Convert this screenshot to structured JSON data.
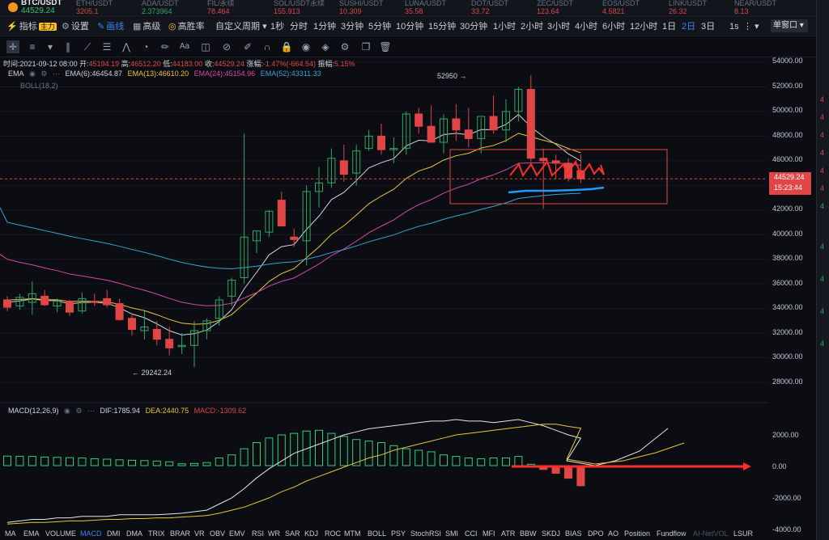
{
  "ticker": {
    "main": {
      "symbol": "BTC/USDT",
      "price": "44529.24"
    },
    "items": [
      {
        "symbol": "ETH/USDT",
        "price": "3205.1",
        "dir": "down"
      },
      {
        "symbol": "ADA/USDT",
        "price": "2.373964",
        "dir": "up"
      },
      {
        "symbol": "FIL/永续",
        "price": "78.464",
        "dir": "down"
      },
      {
        "symbol": "SOL/USDT永续",
        "price": "155.913",
        "dir": "down"
      },
      {
        "symbol": "SUSHI/USDT",
        "price": "10.309",
        "dir": "down"
      },
      {
        "symbol": "LUNA/USDT",
        "price": "35.58",
        "dir": "down"
      },
      {
        "symbol": "DOT/USDT",
        "price": "33.72",
        "dir": "down"
      },
      {
        "symbol": "ZEC/USDT",
        "price": "123.64",
        "dir": "down"
      },
      {
        "symbol": "EOS/USDT",
        "price": "4.5821",
        "dir": "down"
      },
      {
        "symbol": "LINK/USDT",
        "price": "26.32",
        "dir": "down"
      },
      {
        "symbol": "NEAR/USDT",
        "price": "8.13",
        "dir": "down"
      }
    ]
  },
  "toolbar": {
    "indicator": "指标",
    "indicator_badge": "主力",
    "settings": "设置",
    "drawing": "画线",
    "advanced": "高级",
    "win_rate": "高胜率",
    "custom_period": "自定义周期",
    "periods": [
      "1秒",
      "分时",
      "1分钟",
      "3分钟",
      "5分钟",
      "10分钟",
      "15分钟",
      "30分钟",
      "1小时",
      "2小时",
      "3小时",
      "4小时",
      "6小时",
      "12小时",
      "1日",
      "2日",
      "3日"
    ],
    "selected_period": "2日",
    "right_1s": "1s",
    "window_mode": "单窗口"
  },
  "info": {
    "time_label": "时间:",
    "time": "2021-09-12 08:00",
    "open_label": "开:",
    "open": "45194.19",
    "high_label": "高:",
    "high": "46512.20",
    "low_label": "低:",
    "low": "44183.00",
    "close_label": "收:",
    "close": "44529.24",
    "change_label": "涨幅:",
    "change": "-1.47%(-664.54)",
    "amp_label": "振幅:",
    "amp": "5.15%"
  },
  "ema_legend": {
    "name": "EMA",
    "items": [
      {
        "text": "EMA(6):46454.87",
        "color": "#d1d5db"
      },
      {
        "text": "EMA(13):46610.20",
        "color": "#e9c53d"
      },
      {
        "text": "EMA(24):45154.96",
        "color": "#d946a8"
      },
      {
        "text": "EMA(52):43311.33",
        "color": "#38a3d1"
      }
    ]
  },
  "boll_legend": "BOLL(18,2)",
  "macd_legend": {
    "name": "MACD(12,26,9)",
    "dif": "DIF:1785.94",
    "dea": "DEA:2440.75",
    "macd": "MACD:-1309.62"
  },
  "annotations": {
    "high": "52950",
    "low": "29242.24"
  },
  "price_axis": [
    "54000.00",
    "52000.00",
    "50000.00",
    "48000.00",
    "46000.00",
    "44000.00",
    "42000.00",
    "40000.00",
    "38000.00",
    "36000.00",
    "34000.00",
    "32000.00",
    "30000.00",
    "28000.00"
  ],
  "macd_axis": [
    "2000.00",
    "0.00",
    "-2000.00",
    "-4000.00"
  ],
  "price_tag": {
    "price": "44529.24",
    "countdown": "15:23:44"
  },
  "bottom_tabs": [
    "MA",
    "EMA",
    "VOLUME",
    "MACD",
    "DMI",
    "DMA",
    "TRIX",
    "BRAR",
    "VR",
    "OBV",
    "EMV",
    "RSI",
    "WR",
    "SAR",
    "KDJ",
    "ROC",
    "MTM",
    "BOLL",
    "PSY",
    "StochRSI",
    "SMI",
    "CCI",
    "MFI",
    "ATR",
    "BBW",
    "SKDJ",
    "BIAS",
    "DPO",
    "AO",
    "Position",
    "Fundflow",
    "AI-NetVOL",
    "LSUR"
  ],
  "bottom_selected": "MACD",
  "colors": {
    "up": "#2ea865",
    "down": "#e04646",
    "accent": "#3b82f6",
    "bg": "#0b0d12"
  },
  "chart_data": {
    "type": "candlestick",
    "ylim": [
      26000,
      55000
    ],
    "candles": [
      [
        34700,
        35000,
        33800,
        34100
      ],
      [
        34200,
        35200,
        33900,
        34900
      ],
      [
        34500,
        36200,
        33500,
        35200
      ],
      [
        35000,
        35500,
        34200,
        34300
      ],
      [
        34200,
        34800,
        33700,
        34600
      ],
      [
        34600,
        34700,
        33400,
        33700
      ],
      [
        33800,
        35300,
        33600,
        34800
      ],
      [
        34600,
        35200,
        34200,
        34500
      ],
      [
        34800,
        35500,
        34100,
        34300
      ],
      [
        34400,
        34800,
        33000,
        33100
      ],
      [
        33200,
        33600,
        31800,
        32300
      ],
      [
        32200,
        33800,
        31500,
        32500
      ],
      [
        32300,
        33000,
        31000,
        31500
      ],
      [
        31500,
        32500,
        30200,
        30800
      ],
      [
        30900,
        32000,
        30300,
        31000
      ],
      [
        31000,
        33000,
        29242,
        32200
      ],
      [
        32200,
        33200,
        31500,
        33000
      ],
      [
        33200,
        35000,
        32600,
        34700
      ],
      [
        35000,
        36500,
        34200,
        36300
      ],
      [
        36500,
        48200,
        36000,
        39800
      ],
      [
        39500,
        40300,
        38500,
        40300
      ],
      [
        40200,
        42000,
        39800,
        41900
      ],
      [
        42800,
        43500,
        40800,
        40700
      ],
      [
        39800,
        40500,
        39000,
        39600
      ],
      [
        39500,
        44000,
        37500,
        43500
      ],
      [
        43500,
        45500,
        42200,
        44200
      ],
      [
        44200,
        47000,
        43800,
        46200
      ],
      [
        46000,
        47300,
        44300,
        44900
      ],
      [
        45000,
        47300,
        44000,
        46800
      ],
      [
        47000,
        48500,
        46800,
        48000
      ],
      [
        48000,
        49000,
        46500,
        46900
      ],
      [
        46900,
        47900,
        45800,
        47000
      ],
      [
        47000,
        50000,
        46500,
        49800
      ],
      [
        49800,
        50300,
        48200,
        48800
      ],
      [
        48800,
        50500,
        47900,
        47500
      ],
      [
        47500,
        49800,
        46600,
        49400
      ],
      [
        49400,
        50600,
        47600,
        48500
      ],
      [
        48500,
        50300,
        47100,
        47800
      ],
      [
        47800,
        49500,
        46600,
        49600
      ],
      [
        49600,
        51300,
        48200,
        48500
      ],
      [
        48500,
        51000,
        47500,
        50000
      ],
      [
        50000,
        52000,
        49200,
        51800
      ],
      [
        51800,
        52950,
        45900,
        46200
      ],
      [
        46200,
        47000,
        42100,
        46000
      ],
      [
        46000,
        46500,
        44500,
        45800
      ],
      [
        45800,
        46200,
        44300,
        44600
      ],
      [
        45194,
        46512,
        44183,
        44529
      ]
    ],
    "ema_series": [
      {
        "name": "EMA(6)",
        "color": "#d1d5db"
      },
      {
        "name": "EMA(13)",
        "color": "#e9c53d"
      },
      {
        "name": "EMA(24)",
        "color": "#d946a8"
      },
      {
        "name": "EMA(52)",
        "color": "#38a3d1"
      }
    ],
    "macd": {
      "ylim": [
        -4000,
        3000
      ],
      "hist": [
        620,
        610,
        600,
        560,
        540,
        520,
        500,
        450,
        420,
        380,
        350,
        330,
        300,
        250,
        120,
        140,
        200,
        500,
        700,
        1100,
        1500,
        1800,
        2000,
        2100,
        2250,
        2300,
        2100,
        1900,
        1700,
        1600,
        1500,
        1300,
        1100,
        1000,
        900,
        700,
        600,
        500,
        450,
        500,
        500,
        600,
        90,
        -250,
        -500,
        -820,
        -1310
      ],
      "dif": [
        -3700,
        -3600,
        -3500,
        -3500,
        -3400,
        -3400,
        -3300,
        -3300,
        -3300,
        -3200,
        -3200,
        -3200,
        -3200,
        -3150,
        -3100,
        -3000,
        -2900,
        -2500,
        -2100,
        -1500,
        -800,
        -200,
        300,
        800,
        1100,
        1400,
        1700,
        2000,
        2200,
        2400,
        2500,
        2600,
        2700,
        2800,
        2900,
        2900,
        3000,
        2900,
        2900,
        2800,
        2900,
        3000,
        2800,
        2600,
        2300,
        2000,
        1786
      ],
      "dea": [
        -3800,
        -3750,
        -3700,
        -3700,
        -3650,
        -3600,
        -3600,
        -3550,
        -3500,
        -3500,
        -3450,
        -3450,
        -3400,
        -3400,
        -3350,
        -3300,
        -3250,
        -3100,
        -2900,
        -2700,
        -2400,
        -2100,
        -1700,
        -1400,
        -1000,
        -700,
        -400,
        -100,
        200,
        500,
        700,
        1000,
        1200,
        1400,
        1600,
        1800,
        2000,
        2100,
        2200,
        2300,
        2400,
        2500,
        2600,
        2700,
        2700,
        2550,
        2441
      ]
    }
  }
}
